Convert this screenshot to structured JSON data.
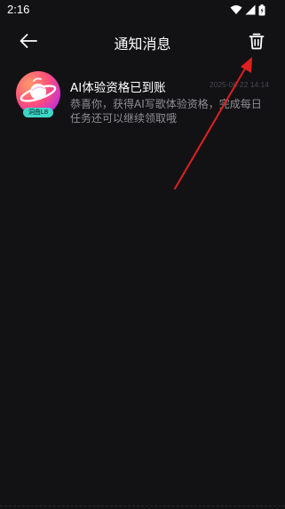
{
  "status_bar": {
    "time": "2:16",
    "icons": [
      "wifi-icon",
      "signal-icon",
      "battery-icon"
    ]
  },
  "header": {
    "title": "通知消息",
    "back_icon": "arrow-left-icon",
    "delete_icon": "trash-icon"
  },
  "notifications": [
    {
      "avatar_icon": "planet-icon",
      "badge": "洞曲L8",
      "title": "AI体验资格已到账",
      "time": "2025-06-22 14:14",
      "body": "恭喜你，获得AI写歌体验资格，完成每日任务还可以继续领取哦"
    }
  ],
  "colors": {
    "background": "#121214",
    "title_text": "#ffffff",
    "body_text": "#8e8e94",
    "time_text": "#4a4a50",
    "badge_bg": "#3ed6c6",
    "annotation": "#e02020"
  }
}
